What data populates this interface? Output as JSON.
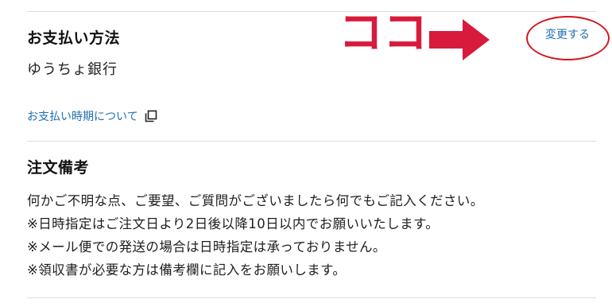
{
  "payment": {
    "title": "お支払い方法",
    "value": "ゆうちょ銀行",
    "change_label": "変更する",
    "info_link_label": "お支払い時期について",
    "info_link_icon": "external-window-icon"
  },
  "annotation": {
    "text": "ココ",
    "color": "#d81b3c"
  },
  "notes": {
    "title": "注文備考",
    "lines": [
      "何かご不明な点、ご要望、ご質問がございましたら何でもご記入ください。",
      "※日時指定はご注文日より2日後以降10日以内でお願いいたします。",
      "※メール便での発送の場合は日時指定は承っておりません。",
      "※領収書が必要な方は備考欄に記入をお願いします。"
    ]
  },
  "colors": {
    "link": "#1f6fb2",
    "highlight": "#d4151f",
    "divider": "#dcdcdc"
  }
}
